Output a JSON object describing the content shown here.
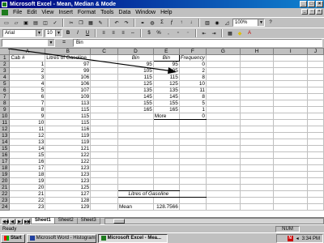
{
  "window": {
    "title": "Microsoft Excel - Mean, Median & Mode"
  },
  "menu": [
    "File",
    "Edit",
    "View",
    "Insert",
    "Format",
    "Tools",
    "Data",
    "Window",
    "Help"
  ],
  "toolbar": {
    "zoom": "100%",
    "font": "Arial",
    "size": "10"
  },
  "formula": {
    "cell_ref": "",
    "equals": "=",
    "content": "Bin"
  },
  "columns": [
    "A",
    "B",
    "C",
    "D",
    "E",
    "F",
    "G",
    "H",
    "I",
    "J"
  ],
  "grid": {
    "headers": {
      "cab": "Cab #",
      "litres": "Litres of Gasoline",
      "bin_d": "Bin",
      "bin_e": "Bin",
      "frequency": "Frequency"
    },
    "rows": [
      [
        "1",
        "97",
        "95",
        "95",
        "0"
      ],
      [
        "2",
        "99",
        "105",
        "105",
        "2"
      ],
      [
        "3",
        "106",
        "115",
        "115",
        "8"
      ],
      [
        "4",
        "106",
        "125",
        "125",
        "10"
      ],
      [
        "5",
        "107",
        "135",
        "135",
        "11"
      ],
      [
        "6",
        "109",
        "145",
        "145",
        "8"
      ],
      [
        "7",
        "113",
        "155",
        "155",
        "5"
      ],
      [
        "8",
        "115",
        "165",
        "165",
        "1"
      ],
      [
        "9",
        "115",
        "",
        "More",
        "0"
      ],
      [
        "10",
        "115",
        "",
        "",
        ""
      ],
      [
        "11",
        "116",
        "",
        "",
        ""
      ],
      [
        "12",
        "119",
        "",
        "",
        ""
      ],
      [
        "13",
        "119",
        "",
        "",
        ""
      ],
      [
        "14",
        "121",
        "",
        "",
        ""
      ],
      [
        "15",
        "122",
        "",
        "",
        ""
      ],
      [
        "16",
        "122",
        "",
        "",
        ""
      ],
      [
        "17",
        "123",
        "",
        "",
        ""
      ],
      [
        "18",
        "123",
        "",
        "",
        ""
      ],
      [
        "19",
        "123",
        "",
        "",
        ""
      ],
      [
        "20",
        "125",
        "",
        "",
        ""
      ],
      [
        "21",
        "127",
        "",
        "",
        ""
      ],
      [
        "22",
        "128",
        "",
        "",
        ""
      ],
      [
        "23",
        "129",
        "",
        "",
        ""
      ]
    ],
    "summary_title": "Litres of Gasoline",
    "mean_label": "Mean",
    "mean_value": "128.7566"
  },
  "sheets": [
    "Sheet1",
    "Sheet2",
    "Sheet3"
  ],
  "status": {
    "left": "Ready",
    "num": "NUM"
  },
  "taskbar": {
    "start": "Start",
    "tasks": [
      "Microsoft Word - Histogram",
      "Microsoft Excel - Mea..."
    ],
    "clock": "3:34 PM",
    "tray_n": "N"
  }
}
